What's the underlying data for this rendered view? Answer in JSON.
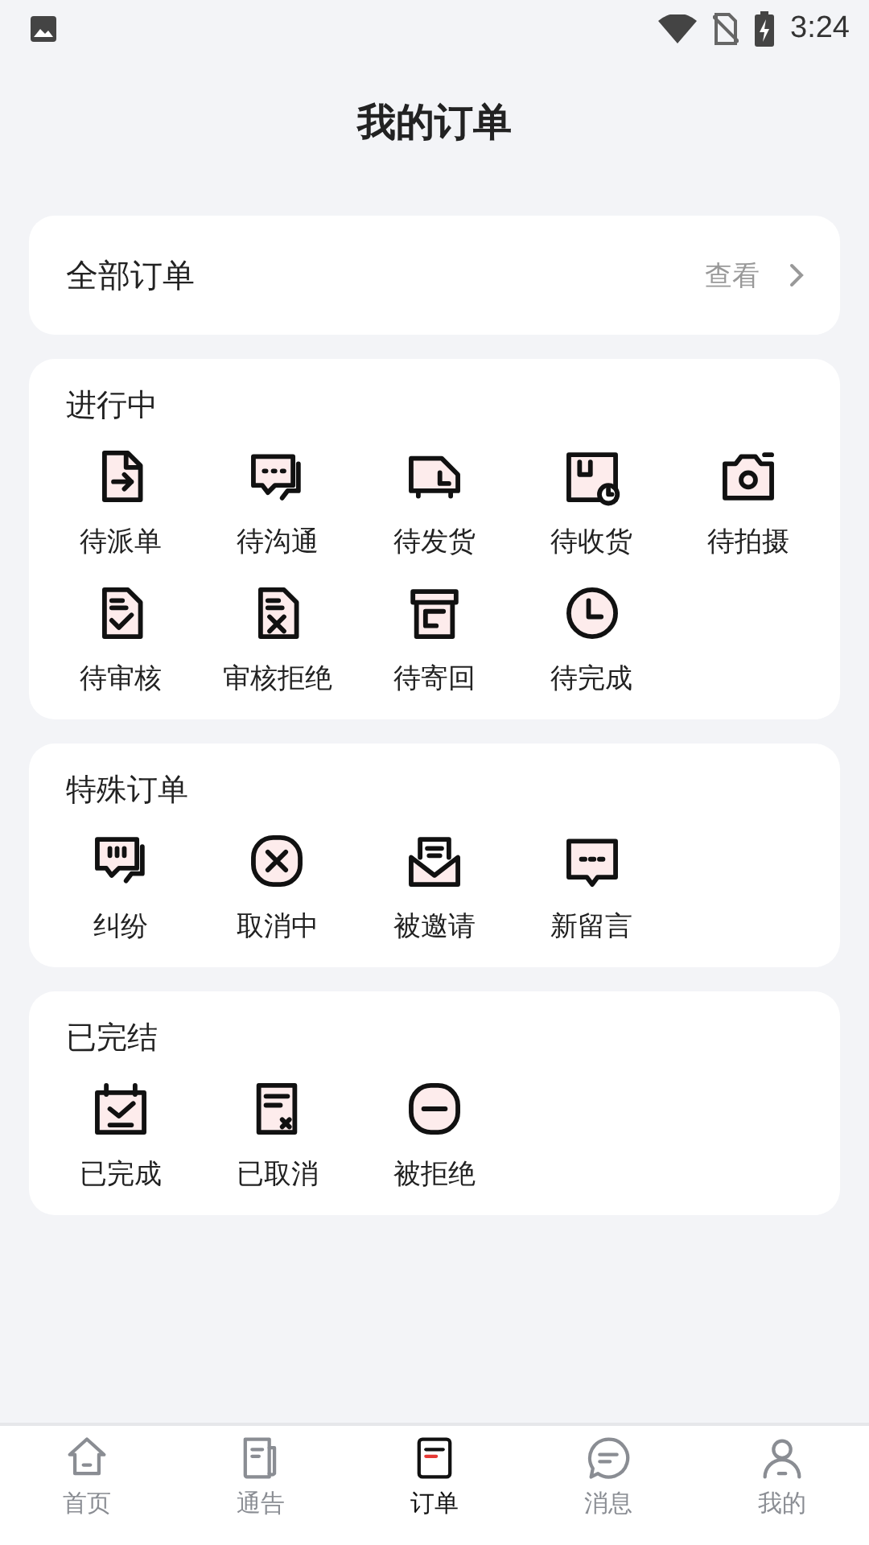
{
  "status_bar": {
    "time": "3:24"
  },
  "title": "我的订单",
  "all_orders": {
    "label": "全部订单",
    "action": "查看"
  },
  "sections": [
    {
      "title": "进行中",
      "items": [
        {
          "label": "待派单"
        },
        {
          "label": "待沟通"
        },
        {
          "label": "待发货"
        },
        {
          "label": "待收货"
        },
        {
          "label": "待拍摄"
        },
        {
          "label": "待审核"
        },
        {
          "label": "审核拒绝"
        },
        {
          "label": "待寄回"
        },
        {
          "label": "待完成"
        }
      ]
    },
    {
      "title": "特殊订单",
      "items": [
        {
          "label": "纠纷"
        },
        {
          "label": "取消中"
        },
        {
          "label": "被邀请"
        },
        {
          "label": "新留言"
        }
      ]
    },
    {
      "title": "已完结",
      "items": [
        {
          "label": "已完成"
        },
        {
          "label": "已取消"
        },
        {
          "label": "被拒绝"
        }
      ]
    }
  ],
  "tab_bar": [
    {
      "label": "首页",
      "selected": false
    },
    {
      "label": "通告",
      "selected": false
    },
    {
      "label": "订单",
      "selected": true
    },
    {
      "label": "消息",
      "selected": false
    },
    {
      "label": "我的",
      "selected": false
    }
  ]
}
